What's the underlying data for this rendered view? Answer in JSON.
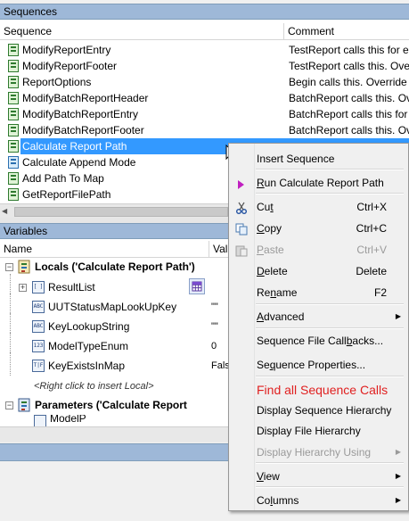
{
  "sequences_pane": {
    "title": "Sequences",
    "col_sequence": "Sequence",
    "col_comment": "Comment",
    "rows": [
      {
        "name": "ModifyReportEntry",
        "comment": "TestReport calls this for each",
        "icon": "green"
      },
      {
        "name": "ModifyReportFooter",
        "comment": "TestReport calls this.  Overrid",
        "icon": "green"
      },
      {
        "name": "ReportOptions",
        "comment": "Begin calls this.  Override it to",
        "icon": "green"
      },
      {
        "name": "ModifyBatchReportHeader",
        "comment": "BatchReport calls this.  Overri",
        "icon": "green"
      },
      {
        "name": "ModifyBatchReportEntry",
        "comment": "BatchReport calls this for each",
        "icon": "green"
      },
      {
        "name": "ModifyBatchReportFooter",
        "comment": "BatchReport calls this.  Overri",
        "icon": "green"
      },
      {
        "name": "Calculate Report Path",
        "comment": "",
        "icon": "green",
        "selected": true
      },
      {
        "name": "Calculate Append Mode",
        "comment": "",
        "icon": "blue"
      },
      {
        "name": "Add Path To Map",
        "comment": "",
        "icon": "green"
      },
      {
        "name": "GetReportFilePath",
        "comment": "",
        "icon": "green"
      }
    ]
  },
  "variables_pane": {
    "title": "Variables",
    "col_name": "Name",
    "col_value": "Val",
    "locals_label": "Locals ('Calculate Report Path')",
    "parameters_label": "Parameters ('Calculate Report",
    "items": [
      {
        "name": "ResultList",
        "value": "",
        "icon": "[ ]",
        "expandable": true
      },
      {
        "name": "UUTStatusMapLookUpKey",
        "value": "\"\"",
        "icon": "ABC"
      },
      {
        "name": "KeyLookupString",
        "value": "\"\"",
        "icon": "ABC"
      },
      {
        "name": "ModelTypeEnum",
        "value": "0",
        "icon": "123"
      },
      {
        "name": "KeyExistsInMap",
        "value": "Fals",
        "icon": "T|F"
      }
    ],
    "insert_hint": "<Right click to insert Local>",
    "partial_row": "ModelP"
  },
  "context_menu": {
    "items": [
      {
        "label": "Insert Sequence",
        "mnemonic": "",
        "shortcut": "",
        "icon": "",
        "submenu": false,
        "state": "normal"
      },
      {
        "label": "Run Calculate Report Path",
        "mnemonic": "R",
        "shortcut": "",
        "icon": "run-icon",
        "submenu": false,
        "state": "normal"
      },
      {
        "label": "Cut",
        "mnemonic": "t",
        "shortcut": "Ctrl+X",
        "icon": "scissors-icon",
        "submenu": false,
        "state": "normal"
      },
      {
        "label": "Copy",
        "mnemonic": "C",
        "shortcut": "Ctrl+C",
        "icon": "copy-icon",
        "submenu": false,
        "state": "normal"
      },
      {
        "label": "Paste",
        "mnemonic": "P",
        "shortcut": "Ctrl+V",
        "icon": "paste-icon",
        "submenu": false,
        "state": "disabled"
      },
      {
        "label": "Delete",
        "mnemonic": "D",
        "shortcut": "Delete",
        "icon": "",
        "submenu": false,
        "state": "normal"
      },
      {
        "label": "Rename",
        "mnemonic": "n",
        "shortcut": "F2",
        "icon": "",
        "submenu": false,
        "state": "normal"
      },
      {
        "label": "Advanced",
        "mnemonic": "A",
        "shortcut": "",
        "icon": "",
        "submenu": true,
        "state": "normal"
      },
      {
        "label": "Sequence File Callbacks...",
        "mnemonic": "b",
        "shortcut": "",
        "icon": "",
        "submenu": false,
        "state": "normal"
      },
      {
        "label": "Sequence Properties...",
        "mnemonic": "q",
        "shortcut": "",
        "icon": "",
        "submenu": false,
        "state": "normal"
      },
      {
        "label": "Find all Sequence Calls",
        "mnemonic": "",
        "shortcut": "",
        "icon": "",
        "submenu": false,
        "state": "highlight-red"
      },
      {
        "label": "Display Sequence Hierarchy",
        "mnemonic": "",
        "shortcut": "",
        "icon": "",
        "submenu": false,
        "state": "normal"
      },
      {
        "label": "Display File Hierarchy",
        "mnemonic": "",
        "shortcut": "",
        "icon": "",
        "submenu": false,
        "state": "normal"
      },
      {
        "label": "Display Hierarchy Using",
        "mnemonic": "",
        "shortcut": "",
        "icon": "",
        "submenu": true,
        "state": "disabled"
      },
      {
        "label": "View",
        "mnemonic": "V",
        "shortcut": "",
        "icon": "",
        "submenu": true,
        "state": "normal"
      },
      {
        "label": "Columns",
        "mnemonic": "l",
        "shortcut": "",
        "icon": "",
        "submenu": true,
        "state": "normal"
      }
    ]
  }
}
